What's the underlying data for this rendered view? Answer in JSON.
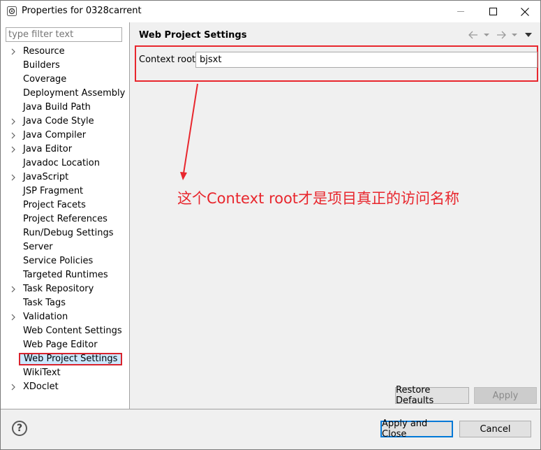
{
  "window": {
    "title": "Properties for 0328carrent"
  },
  "sidebar": {
    "filter_placeholder": "type filter text",
    "items": [
      {
        "label": "Resource",
        "expandable": true
      },
      {
        "label": "Builders",
        "expandable": false
      },
      {
        "label": "Coverage",
        "expandable": false
      },
      {
        "label": "Deployment Assembly",
        "expandable": false
      },
      {
        "label": "Java Build Path",
        "expandable": false
      },
      {
        "label": "Java Code Style",
        "expandable": true
      },
      {
        "label": "Java Compiler",
        "expandable": true
      },
      {
        "label": "Java Editor",
        "expandable": true
      },
      {
        "label": "Javadoc Location",
        "expandable": false
      },
      {
        "label": "JavaScript",
        "expandable": true
      },
      {
        "label": "JSP Fragment",
        "expandable": false
      },
      {
        "label": "Project Facets",
        "expandable": false
      },
      {
        "label": "Project References",
        "expandable": false
      },
      {
        "label": "Run/Debug Settings",
        "expandable": false
      },
      {
        "label": "Server",
        "expandable": false
      },
      {
        "label": "Service Policies",
        "expandable": false
      },
      {
        "label": "Targeted Runtimes",
        "expandable": false
      },
      {
        "label": "Task Repository",
        "expandable": true
      },
      {
        "label": "Task Tags",
        "expandable": false
      },
      {
        "label": "Validation",
        "expandable": true
      },
      {
        "label": "Web Content Settings",
        "expandable": false
      },
      {
        "label": "Web Page Editor",
        "expandable": false
      },
      {
        "label": "Web Project Settings",
        "expandable": false,
        "selected": true
      },
      {
        "label": "WikiText",
        "expandable": false
      },
      {
        "label": "XDoclet",
        "expandable": true
      }
    ]
  },
  "main": {
    "title": "Web Project Settings",
    "context_root_label": "Context root:",
    "context_root_value": "bjsxt",
    "annotation": "这个Context root才是项目真正的访问名称",
    "restore_defaults_label": "Restore Defaults",
    "apply_label": "Apply"
  },
  "footer": {
    "help_label": "?",
    "apply_close_label": "Apply and Close",
    "cancel_label": "Cancel"
  },
  "colors": {
    "annotation_red": "#e8262d",
    "selection_bg": "#cce8ff",
    "default_button_border": "#0078d7"
  }
}
